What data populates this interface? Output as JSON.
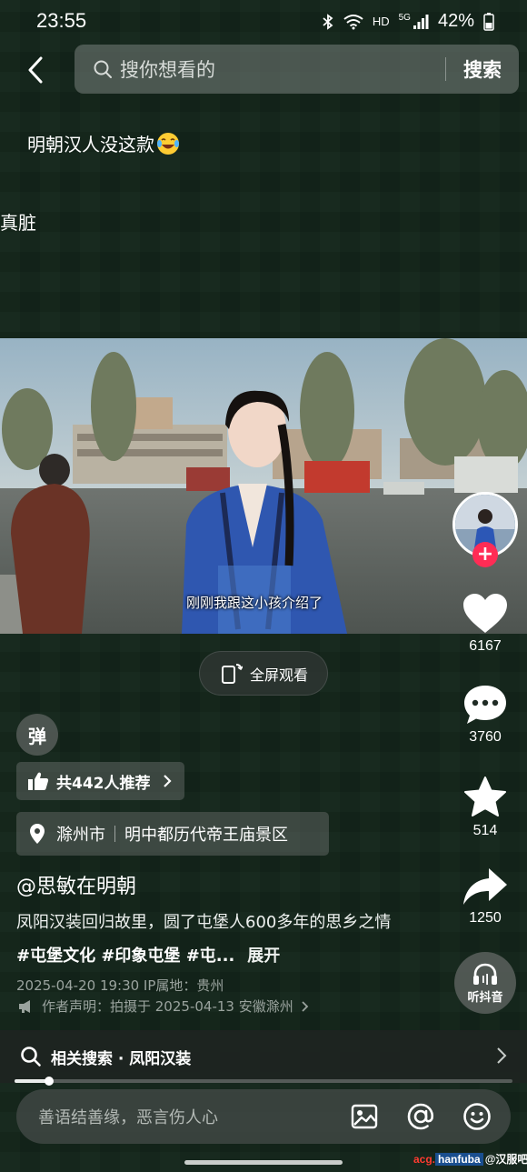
{
  "status_bar": {
    "time": "23:55",
    "network": "HD",
    "signal": "5G",
    "battery": "42%"
  },
  "header": {
    "back_icon": "chevron-left-icon",
    "search_placeholder": "搜你想看的",
    "search_button": "搜索"
  },
  "danmaku": {
    "line1": "明朝汉人没这款",
    "line1_emoji": "laughing-crying-emoji",
    "line2": "真脏"
  },
  "video": {
    "subtitle": "刚刚我跟这小孩介绍了",
    "fullscreen_label": "全屏观看"
  },
  "right_rail": {
    "likes": "6167",
    "comments": "3760",
    "favorites": "514",
    "shares": "1250",
    "listen_label": "听抖音"
  },
  "info": {
    "danmaku_toggle": "弹",
    "recommend": "共442人推荐",
    "city": "滁州市",
    "poi": "明中都历代帝王庙景区",
    "author": "@思敏在明朝",
    "desc_text": "凤阳汉装回归故里，圆了屯堡人600多年的思乡之情",
    "hashtags": "#屯堡文化 #印象屯堡 #屯...",
    "expand": "展开",
    "meta": "2025-04-20 19:30  IP属地：贵州",
    "declaration": "作者声明：拍摄于 2025-04-13 安徽滁州"
  },
  "related_search": {
    "label": "相关搜索 · 凤阳汉装"
  },
  "playback": {
    "progress": 0.07
  },
  "comment_bar": {
    "placeholder": "善语结善缘，恶言伤人心"
  },
  "watermark": {
    "site": "acg.",
    "box": "hanfuba",
    "logo": "@汉服吧"
  },
  "colors": {
    "background": "#122419",
    "accent": "#ff2c55"
  }
}
